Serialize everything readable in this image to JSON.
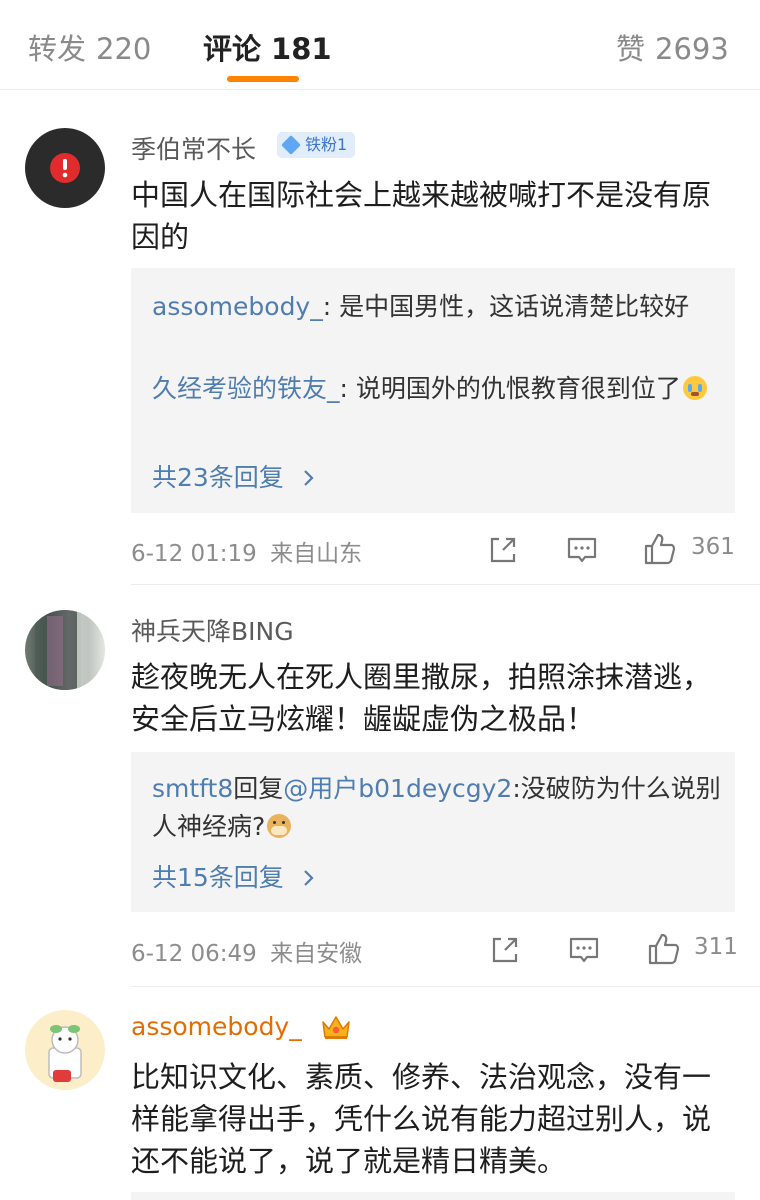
{
  "tabs": {
    "repost": {
      "label": "转发",
      "count": "220"
    },
    "comment": {
      "label": "评论",
      "count": "181"
    },
    "like": {
      "label": "赞",
      "count": "2693"
    }
  },
  "colors": {
    "accent": "#ff8200",
    "link": "#507daf",
    "vip_name": "#e36d00"
  },
  "comments": [
    {
      "username": "季伯常不长",
      "badge": "铁粉1",
      "avatar_icon": "alert-icon",
      "text": "中国人在国际社会上越来越被喊打不是没有原因的",
      "replies": [
        {
          "name": "assomebody_",
          "sep": ": ",
          "text": "是中国男性，这话说清楚比较好"
        },
        {
          "name": "久经考验的铁友_",
          "sep": ": ",
          "text": "说明国外的仇恨教育很到位了"
        }
      ],
      "more_replies": "共23条回复",
      "date": "6-12 01:19",
      "location": "来自山东",
      "likes": "361"
    },
    {
      "username": "神兵天降BING",
      "avatar_icon": "photo-avatar",
      "text": "趁夜晚无人在死人圈里撒尿，拍照涂抹潜逃，安全后立马炫耀！龌龊虚伪之极品！",
      "reply": {
        "name": "smtft8",
        "reply_word": "回复",
        "mention": "@用户b01deycgy2",
        "sep": ":",
        "text": "没破防为什么说别人神经病?"
      },
      "more_replies": "共15条回复",
      "date": "6-12 06:49",
      "location": "来自安徽",
      "likes": "311"
    },
    {
      "username": "assomebody_",
      "avatar_icon": "cartoon-dog-avatar",
      "badge_icon": "crown-icon",
      "text": "比知识文化、素质、修养、法治观念，没有一样能拿得出手，凭什么说有能力超过别人，说还不能说了，说了就是精日精美。"
    }
  ]
}
